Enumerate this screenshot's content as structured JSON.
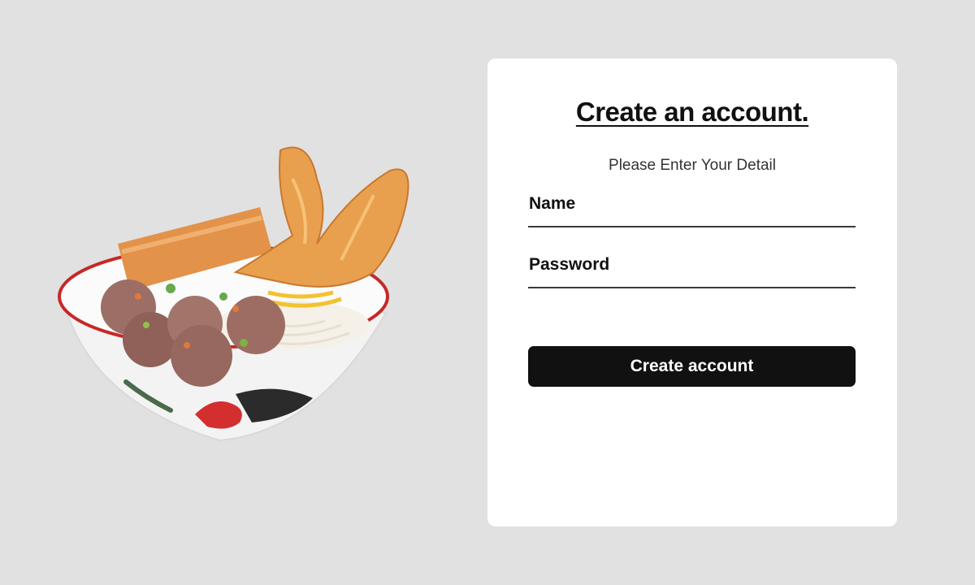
{
  "form": {
    "title": "Create an account.",
    "subtitle": "Please Enter Your Detail",
    "name_label": "Name",
    "name_value": "",
    "password_label": "Password",
    "password_value": "",
    "submit_label": "Create account"
  },
  "hero": {
    "image": "bowl-of-meatball-noodle-soup-with-fried-wonton"
  },
  "colors": {
    "page_background": "#e1e1e1",
    "card_background": "#ffffff",
    "text_primary": "#111111",
    "button_background": "#111111",
    "button_text": "#ffffff",
    "field_underline": "#3a3a3a"
  }
}
